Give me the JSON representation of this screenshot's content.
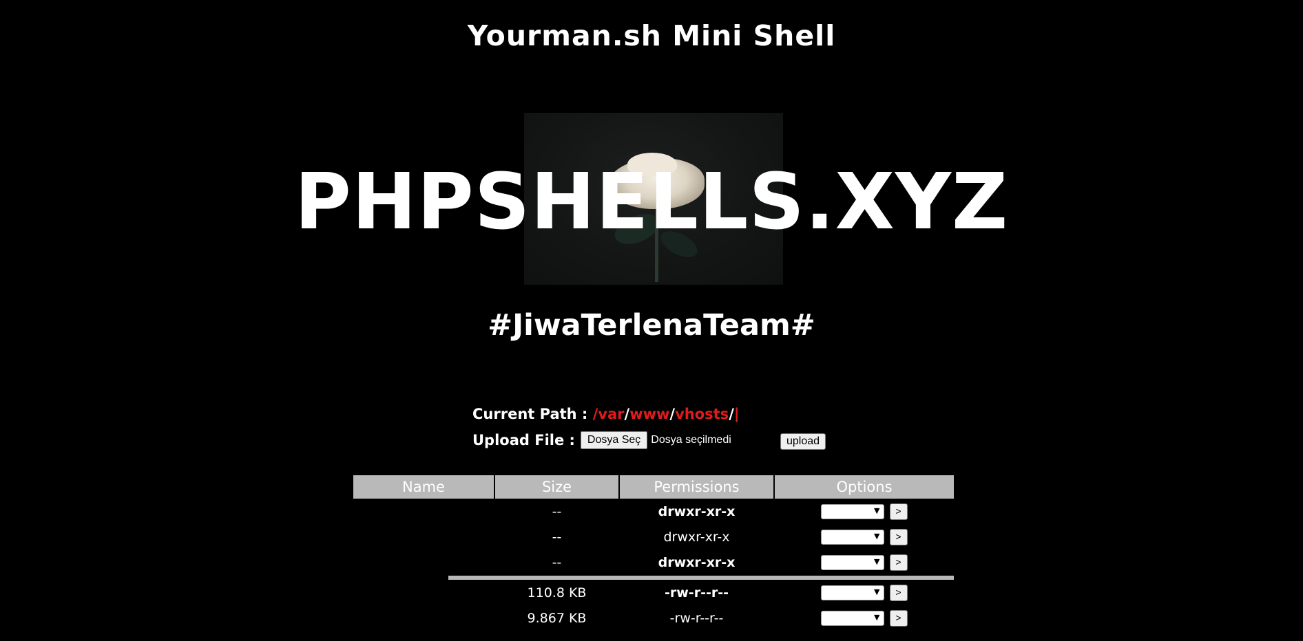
{
  "header": {
    "title": "Yourman.sh Mini Shell",
    "banner_overlay": "PHPSHELLS.XYZ",
    "team_tag": "#JiwaTerlenaTeam#"
  },
  "path": {
    "label": "Current Path :",
    "segments": [
      "/var",
      "www",
      "vhosts",
      ""
    ],
    "separator": "/",
    "trailing": "|"
  },
  "upload": {
    "label": "Upload File :",
    "choose_label": "Dosya Seç",
    "no_file_text": "Dosya seçilmedi",
    "submit_label": "upload"
  },
  "table": {
    "headers": {
      "name": "Name",
      "size": "Size",
      "permissions": "Permissions",
      "options": "Options"
    },
    "rows": [
      {
        "name": "",
        "size": "--",
        "perm": "drwxr-xr-x",
        "perm_color": "green"
      },
      {
        "name": "",
        "size": "--",
        "perm": "drwxr-xr-x",
        "perm_color": "white"
      },
      {
        "name": "",
        "size": "--",
        "perm": "drwxr-xr-x",
        "perm_color": "green"
      },
      {
        "name": "",
        "size": "110.8 KB",
        "perm": "-rw-r--r--",
        "perm_color": "green"
      },
      {
        "name": "",
        "size": "9.867 KB",
        "perm": "-rw-r--r--",
        "perm_color": "white"
      }
    ],
    "go_label": ">"
  },
  "colors": {
    "background": "#000000",
    "path_link": "#e11b1b",
    "perm_green": "#2e8b2e",
    "header_bg": "#b9b9b9"
  }
}
